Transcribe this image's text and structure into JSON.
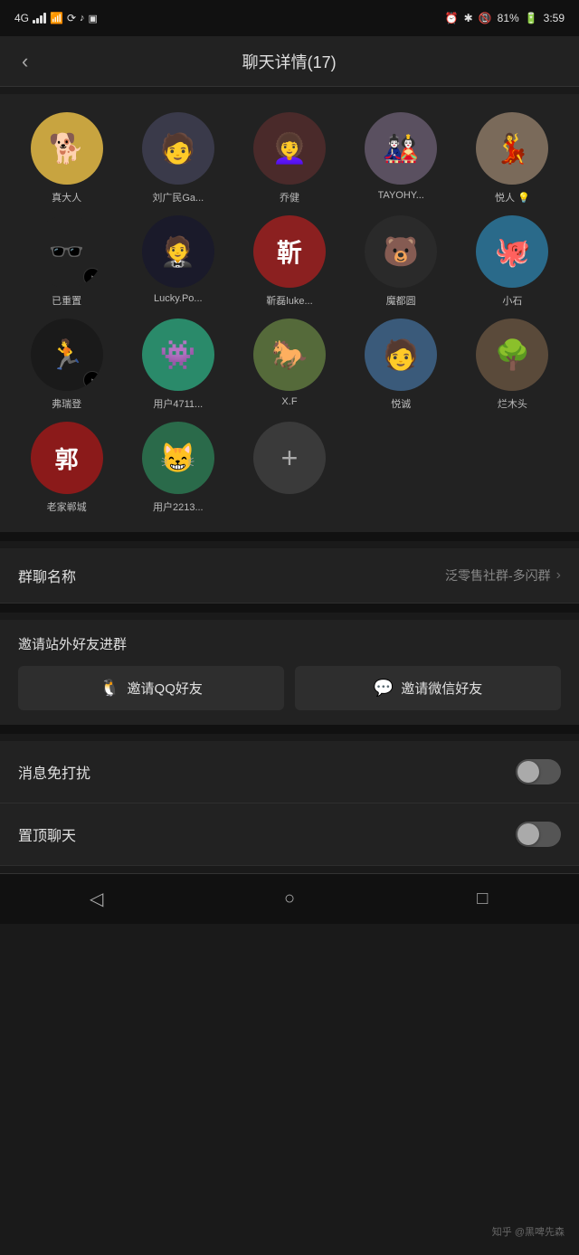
{
  "statusBar": {
    "signal": "4G",
    "wifi": "WiFi",
    "icons": [
      "alarm",
      "bluetooth",
      "screen",
      "battery"
    ],
    "battery": "81%",
    "time": "3:59"
  },
  "header": {
    "backLabel": "‹",
    "title": "聊天详情(17)"
  },
  "members": [
    {
      "id": 1,
      "name": "真大人",
      "color": "#c8a440",
      "emoji": "🐕",
      "badge": ""
    },
    {
      "id": 2,
      "name": "刘广民Ga...",
      "color": "#4a4a5a",
      "emoji": "👤",
      "badge": ""
    },
    {
      "id": 3,
      "name": "乔健",
      "color": "#6a3a3a",
      "emoji": "👩",
      "badge": ""
    },
    {
      "id": 4,
      "name": "TAYOHY...",
      "color": "#5a5a7a",
      "emoji": "🎨",
      "badge": ""
    },
    {
      "id": 5,
      "name": "悦人 💡",
      "color": "#7a6a5a",
      "emoji": "👗",
      "badge": ""
    },
    {
      "id": 6,
      "name": "已重置",
      "color": "#2a2a2a",
      "emoji": "🕶",
      "badge": "tiktok"
    },
    {
      "id": 7,
      "name": "Lucky.Po...",
      "color": "#1a1a2a",
      "emoji": "🤵",
      "badge": ""
    },
    {
      "id": 8,
      "name": "靳磊luke...",
      "color": "#8b2020",
      "emoji": "靳",
      "badge": ""
    },
    {
      "id": 9,
      "name": "魔都圆",
      "color": "#2a2a2a",
      "emoji": "🐻",
      "badge": ""
    },
    {
      "id": 10,
      "name": "小石",
      "color": "#2a6a8a",
      "emoji": "🐙",
      "badge": ""
    },
    {
      "id": 11,
      "name": "弗瑞登",
      "color": "#1a1a1a",
      "emoji": "🏃",
      "badge": "tiktok"
    },
    {
      "id": 12,
      "name": "用户4711...",
      "color": "#2a7a6a",
      "emoji": "👾",
      "badge": ""
    },
    {
      "id": 13,
      "name": "X.F",
      "color": "#4a6a3a",
      "emoji": "🐴",
      "badge": ""
    },
    {
      "id": 14,
      "name": "悦诚",
      "color": "#3a5a7a",
      "emoji": "🧑",
      "badge": ""
    },
    {
      "id": 15,
      "name": "烂木头",
      "color": "#5a4a3a",
      "emoji": "🌿",
      "badge": ""
    },
    {
      "id": 16,
      "name": "老家郸城",
      "color": "#8b2020",
      "emoji": "郭",
      "badge": ""
    },
    {
      "id": 17,
      "name": "用户2213...",
      "color": "#2a6a4a",
      "emoji": "😺",
      "badge": ""
    },
    {
      "id": 18,
      "name": "+",
      "isAdd": true
    }
  ],
  "groupName": {
    "label": "群聊名称",
    "value": "泛零售社群-多闪群"
  },
  "invite": {
    "title": "邀请站外好友进群",
    "qqLabel": "邀请QQ好友",
    "wechatLabel": "邀请微信好友"
  },
  "toggles": [
    {
      "id": "mute",
      "label": "消息免打扰",
      "on": false
    },
    {
      "id": "pin",
      "label": "置顶聊天",
      "on": false
    }
  ],
  "bottomNav": {
    "back": "◁",
    "home": "○",
    "recent": "□"
  },
  "watermark": "知乎 @黑啤先森"
}
